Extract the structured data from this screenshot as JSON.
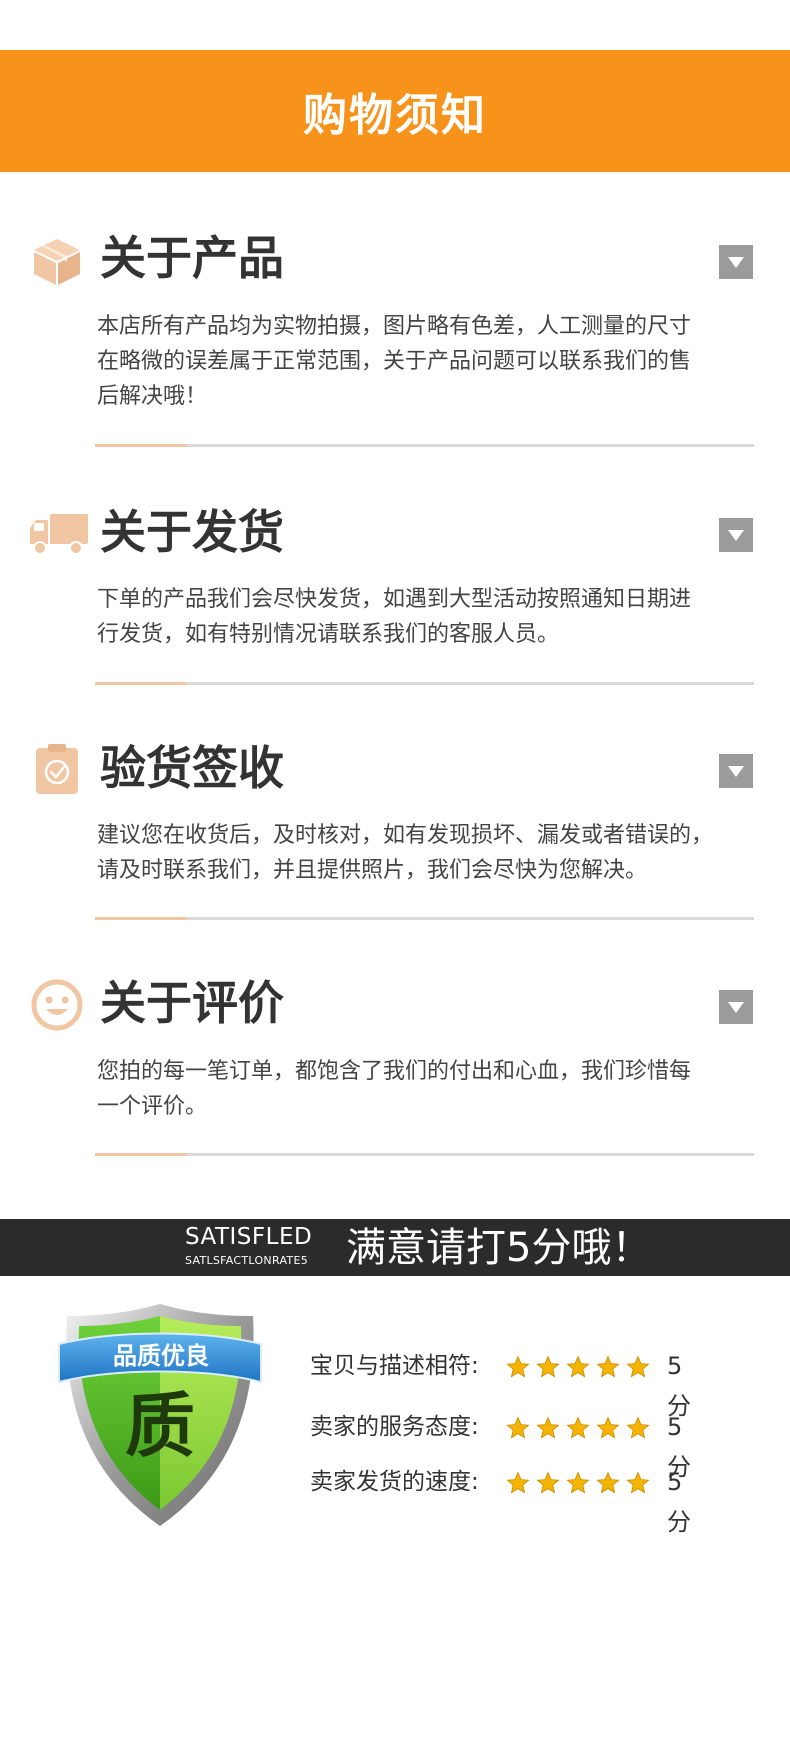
{
  "header": {
    "title": "购物须知"
  },
  "sections": [
    {
      "icon": "box-icon",
      "title": "关于产品",
      "body": "本店所有产品均为实物拍摄，图片略有色差，人工测量的尺寸\n在略微的误差属于正常范围，关于产品问题可以联系我们的售\n后解决哦！"
    },
    {
      "icon": "delivery-truck-icon",
      "title": "关于发货",
      "body": "下单的产品我们会尽快发货，如遇到大型活动按照通知日期进\n行发货，如有特别情况请联系我们的客服人员。"
    },
    {
      "icon": "clipboard-check-icon",
      "title": "验货签收",
      "body": "建议您在收货后，及时核对，如有发现损坏、漏发或者错误的，\n请及时联系我们，并且提供照片，我们会尽快为您解决。"
    },
    {
      "icon": "smiley-face-icon",
      "title": "关于评价",
      "body": "您拍的每一笔订单，都饱含了我们的付出和心血，我们珍惜每\n一个评价。"
    }
  ],
  "satisfaction": {
    "title_en": "SATISFLED",
    "subtitle_en": "SATLSFACTLONRATE5",
    "title_cn": "满意请打5分哦！"
  },
  "quality_badge": {
    "banner": "品质优良",
    "character": "质"
  },
  "ratings": [
    {
      "label": "宝贝与描述相符:",
      "stars": 5,
      "score": "5分"
    },
    {
      "label": "卖家的服务态度:",
      "stars": 5,
      "score": "5分"
    },
    {
      "label": "卖家发货的速度:",
      "stars": 5,
      "score": "5分"
    }
  ],
  "colors": {
    "accent": "#f7931a",
    "icon_tint": "#f0c6a3",
    "dark_bar": "#2b2b2b",
    "shield_green": "#5cb82a",
    "shield_blue": "#2f8fd8",
    "star_gold": "#f5b400"
  }
}
